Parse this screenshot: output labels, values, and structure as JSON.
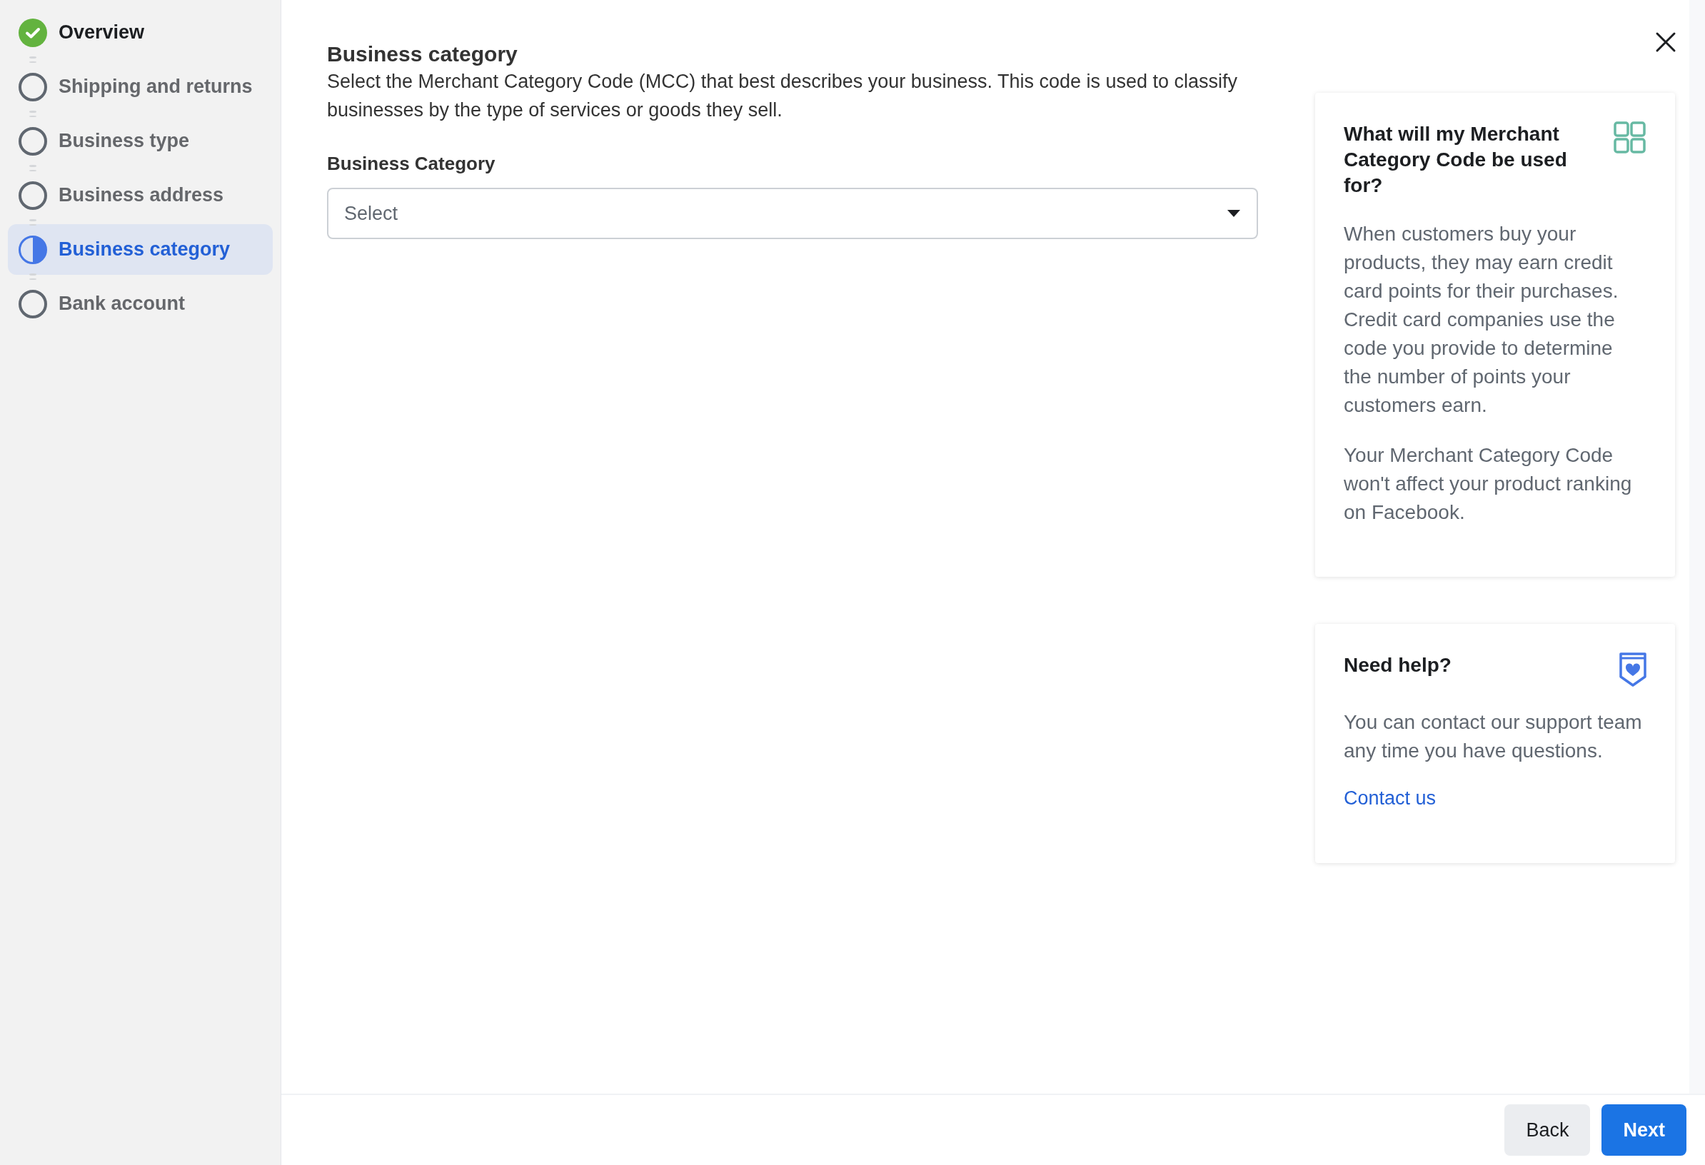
{
  "steps": [
    {
      "label": "Overview",
      "kind": "complete",
      "selected": false
    },
    {
      "label": "Shipping and returns",
      "kind": "pending",
      "selected": false
    },
    {
      "label": "Business type",
      "kind": "pending",
      "selected": false
    },
    {
      "label": "Business address",
      "kind": "pending",
      "selected": false
    },
    {
      "label": "Business category",
      "kind": "partial",
      "selected": true
    },
    {
      "label": "Bank account",
      "kind": "pending",
      "selected": false
    }
  ],
  "section": {
    "title": "Business category",
    "description": "Select the Merchant Category Code (MCC) that best describes your business. This code is used to classify businesses by the type of services or goods they sell.",
    "field_label": "Business Category",
    "dropdown": {
      "placeholder": "Select"
    }
  },
  "info_cards": [
    {
      "kind": "grid",
      "title": "What will my Merchant Category Code be used for?",
      "paragraphs": [
        "When customers buy your products, they may earn credit card points for their purchases. Credit card companies use the code you provide to determine the number of points your customers earn.",
        "Your Merchant Category Code won't affect your product ranking on Facebook."
      ]
    },
    {
      "kind": "support",
      "title": "Need help?",
      "paragraphs": [
        "You can contact our support team any time you have questions."
      ],
      "link": "Contact us"
    }
  ],
  "footer": {
    "buttons": [
      {
        "label": "Back",
        "kind": "secondary"
      },
      {
        "label": "Next",
        "kind": "primary"
      }
    ]
  }
}
